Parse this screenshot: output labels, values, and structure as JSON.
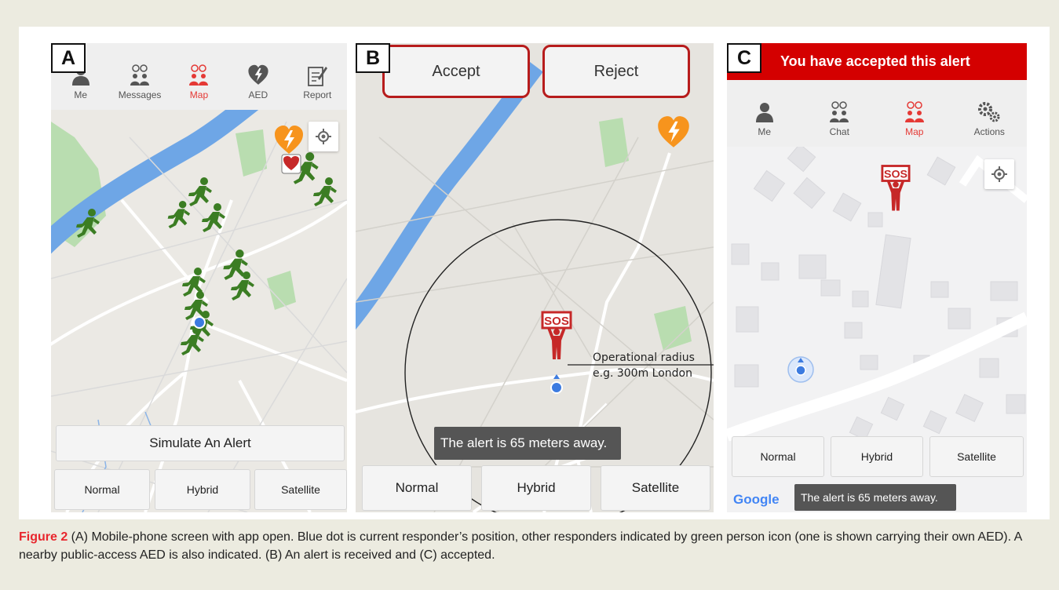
{
  "panels": {
    "a": {
      "letter": "A",
      "nav": [
        {
          "label": "Me",
          "icon": "person-icon",
          "active": false
        },
        {
          "label": "Messages",
          "icon": "chat-people-icon",
          "active": false
        },
        {
          "label": "Map",
          "icon": "map-people-icon",
          "active": true
        },
        {
          "label": "AED",
          "icon": "aed-heart-icon",
          "active": false
        },
        {
          "label": "Report",
          "icon": "report-icon",
          "active": false
        }
      ],
      "simulate_label": "Simulate An Alert",
      "map_types": [
        "Normal",
        "Hybrid",
        "Satellite"
      ]
    },
    "b": {
      "letter": "B",
      "accept_label": "Accept",
      "reject_label": "Reject",
      "sos_text": "SOS",
      "radius_line1": "Operational radius",
      "radius_line2": "e.g. 300m London",
      "toast": "The alert is 65 meters away.",
      "map_types": [
        "Normal",
        "Hybrid",
        "Satellite"
      ]
    },
    "c": {
      "letter": "C",
      "header": "You have accepted this alert",
      "nav": [
        {
          "label": "Me",
          "icon": "person-icon",
          "active": false
        },
        {
          "label": "Chat",
          "icon": "chat-people-icon",
          "active": false
        },
        {
          "label": "Map",
          "icon": "map-people-icon",
          "active": true
        },
        {
          "label": "Actions",
          "icon": "gears-icon",
          "active": false
        }
      ],
      "sos_text": "SOS",
      "map_types": [
        "Normal",
        "Hybrid",
        "Satellite"
      ],
      "google": "Google",
      "toast": "The alert is 65 meters away."
    }
  },
  "caption": {
    "label": "Figure 2",
    "text": " (A) Mobile-phone screen with app open. Blue dot is current responder’s position, other responders indicated by green person icon (one is shown carrying their own AED). A nearby public-access AED is also indicated. (B) An alert is received and (C) accepted."
  },
  "colors": {
    "responder_green": "#3b7d23",
    "sos_red": "#c62828",
    "aed_orange": "#f7941d",
    "active_red": "#e53935",
    "header_red": "#d40000",
    "user_blue": "#3c7be0",
    "river_blue": "#6ea6e6",
    "park_green": "#b9ddb0"
  }
}
